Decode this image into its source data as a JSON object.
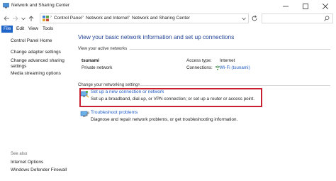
{
  "window": {
    "title": "Network and Sharing Center",
    "controls": {
      "minimize": "—",
      "maximize": "☐",
      "close": "✕"
    }
  },
  "address": {
    "breadcrumbs": [
      "Control Panel",
      "Network and Internet",
      "Network and Sharing Center"
    ],
    "search_placeholder": ""
  },
  "menu": [
    "File",
    "Edit",
    "View",
    "Tools"
  ],
  "sidebar": {
    "links": [
      "Control Panel Home",
      "Change adapter settings",
      "Change advanced sharing",
      "settings",
      "Media streaming options"
    ],
    "see_also_heading": "See also",
    "see_also": [
      "Internet Options",
      "Windows Defender Firewall"
    ]
  },
  "main": {
    "title": "View your basic network information and set up connections",
    "active_networks_label": "View your active networks",
    "network": {
      "name": "tsunami",
      "type": "Private network",
      "access_type_label": "Access type:",
      "access_type_value": "Internet",
      "connections_label": "Connections:",
      "connections_value": "Wi-Fi (tsunami)"
    },
    "change_settings_label": "Change your networking settings",
    "tasks": [
      {
        "link": "Set up a new connection or network",
        "desc": "Set up a broadband, dial-up, or VPN connection; or set up a router or access point."
      },
      {
        "link": "Troubleshoot problems",
        "desc": "Diagnose and repair network problems, or get troubleshooting information."
      }
    ]
  },
  "colors": {
    "link": "#1e5bc6",
    "title": "#1c3f94",
    "highlight": "#c8202f",
    "menu_active": "#1e63c8"
  }
}
